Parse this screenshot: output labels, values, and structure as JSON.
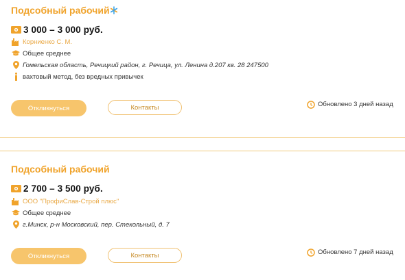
{
  "vacancies": [
    {
      "title": "Подсобный рабочий",
      "salary": "3 000 – 3 000 руб.",
      "employer": "Корниенко С. М.",
      "education": "Общее среднее",
      "address": "Гомельская область, Речицкий район, г. Речица, ул. Ленина д.207 кв. 28 247500",
      "conditions": "вахтовый метод, без вредных привычек",
      "apply_label": "Откликнуться",
      "contacts_label": "Контакты",
      "updated": "Обновлено 3 дней назад"
    },
    {
      "title": "Подсобный рабочий",
      "salary": "2 700 – 3 500 руб.",
      "employer": "ООО \"ПрофиСлав-Строй плюс\"",
      "education": "Общее среднее",
      "address": "г.Минск, р-н Московский, пер. Стекольный, д. 7",
      "apply_label": "Откликнуться",
      "contacts_label": "Контакты",
      "updated": "Обновлено 7 дней назад"
    }
  ],
  "colors": {
    "accent": "#f0a32b",
    "button": "#f7c56c",
    "divider": "#f1c97b"
  },
  "icons": [
    "money-icon",
    "factory-icon",
    "graduation-cap-icon",
    "location-pin-icon",
    "info-icon",
    "clock-icon",
    "star-icon"
  ]
}
